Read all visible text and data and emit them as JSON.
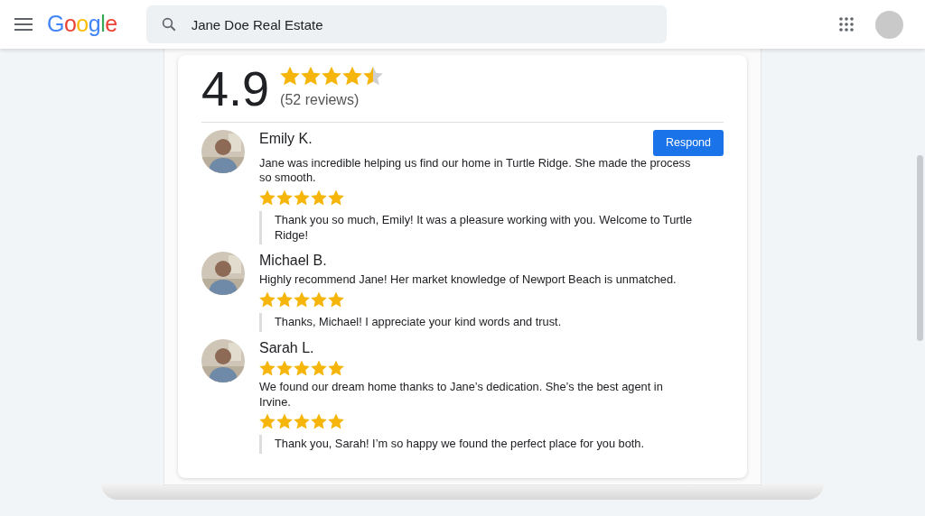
{
  "header": {
    "logo": "Google",
    "search": {
      "value": "Jane Doe Real Estate"
    }
  },
  "summary": {
    "rating": "4.9",
    "stars": 4.5,
    "count": "(52 reviews)"
  },
  "reviews": [
    {
      "name": "Emily K.",
      "button": "Respond",
      "blocks": [
        {
          "kind": "text",
          "text": "Jane was incredible helping us find our home in Turtle Ridge. She made the process so smooth."
        },
        {
          "kind": "stars",
          "stars": 5
        }
      ],
      "reply": "Thank you so much, Emily! It was a pleasure working with you. Welcome to Turtle Ridge!"
    },
    {
      "name": "Michael B.",
      "blocks": [
        {
          "kind": "text",
          "text": "Highly recommend Jane! Her market knowledge of Newport Beach is unmatched."
        },
        {
          "kind": "stars",
          "stars": 5
        }
      ],
      "reply": "Thanks, Michael! I appreciate your kind words and trust."
    },
    {
      "name": "Sarah L.",
      "blocks": [
        {
          "kind": "stars",
          "stars": 5
        },
        {
          "kind": "text",
          "text": "We found our dream home thanks to Jane’s dedication. She’s the best agent in Irvine."
        },
        {
          "kind": "stars",
          "stars": 5
        }
      ],
      "reply": "Thank you, Sarah! I’m so happy we found the perfect place for you both."
    }
  ]
}
